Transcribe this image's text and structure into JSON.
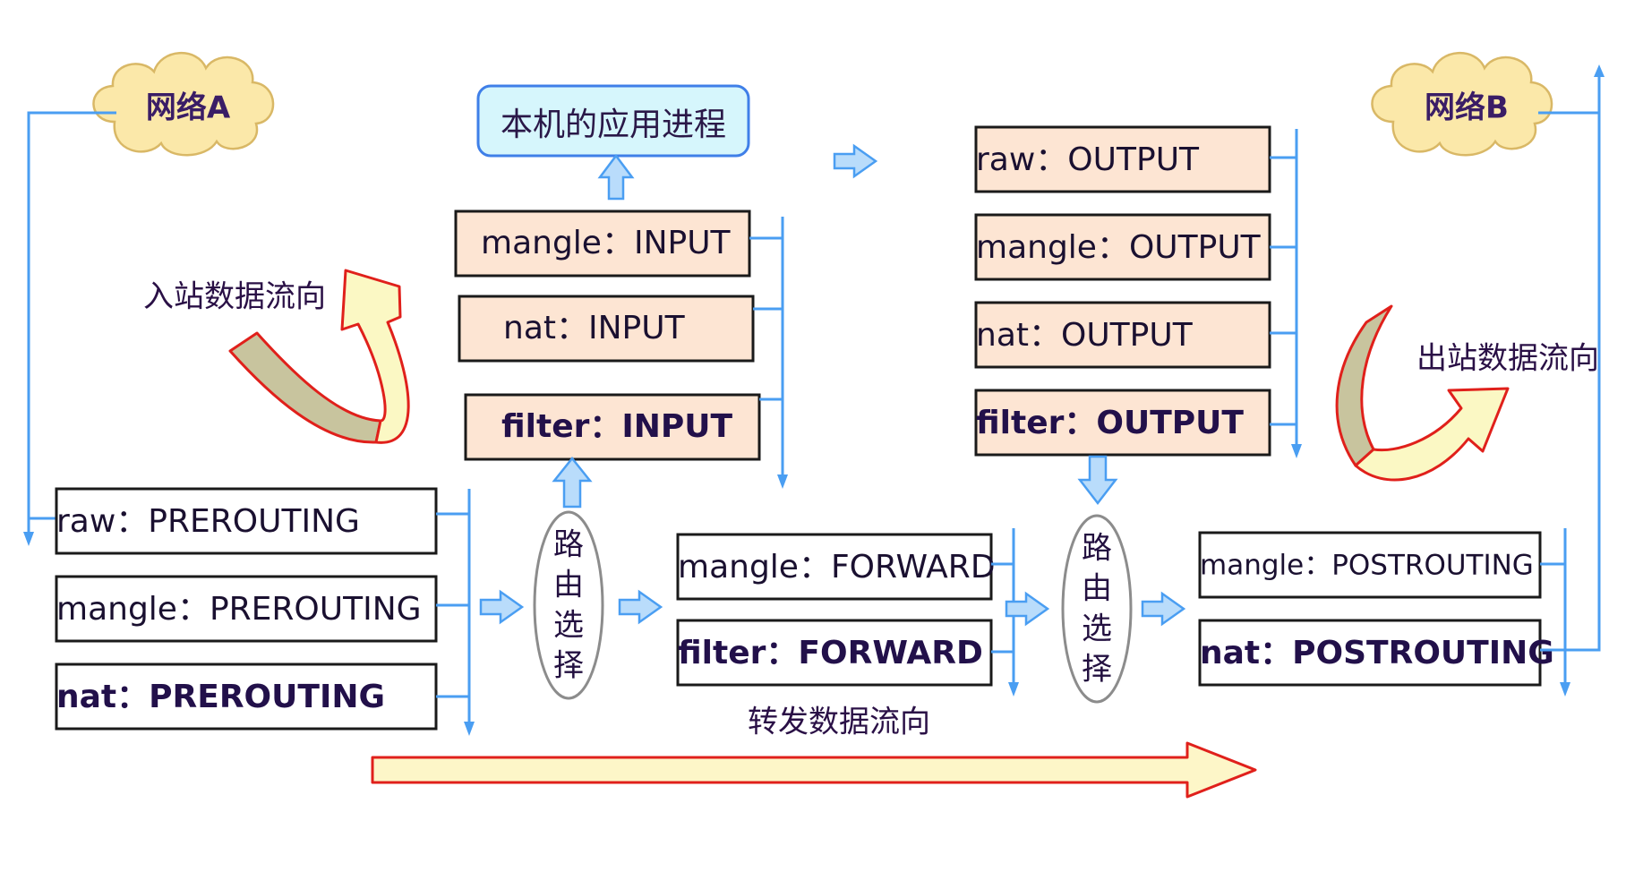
{
  "network_a": "网络A",
  "network_b": "网络B",
  "app_process": "本机的应用进程",
  "inbound_label": "入站数据流向",
  "outbound_label": "出站数据流向",
  "forward_label": "转发数据流向",
  "routing_decision": [
    "路",
    "由",
    "选",
    "择"
  ],
  "input_chain": [
    "mangle：INPUT",
    "nat：INPUT",
    "filter：INPUT"
  ],
  "output_chain": [
    "raw：OUTPUT",
    "mangle：OUTPUT",
    "nat：OUTPUT",
    "filter：OUTPUT"
  ],
  "prerouting_chain": [
    "raw：PREROUTING",
    "mangle：PREROUTING",
    "nat：PREROUTING"
  ],
  "forward_chain": [
    "mangle：FORWARD",
    "filter：FORWARD"
  ],
  "postrouting_chain": [
    "mangle：POSTROUTING",
    "nat：POSTROUTING"
  ]
}
